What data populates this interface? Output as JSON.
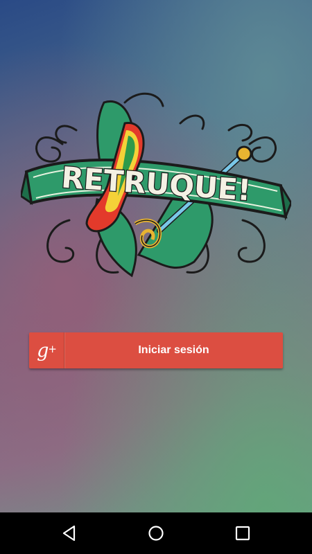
{
  "app": {
    "logo_text": "RETRUQUE!"
  },
  "login": {
    "button_label": "Iniciar sesión",
    "icon": "google-plus-icon",
    "icon_glyph": "g",
    "icon_plus": "+"
  },
  "navbar": {
    "back_icon": "back-triangle-icon",
    "home_icon": "home-circle-icon",
    "recents_icon": "recents-square-icon"
  },
  "colors": {
    "button": "#dc4e41",
    "banner_green": "#2e9a6a",
    "navbar": "#000000"
  }
}
